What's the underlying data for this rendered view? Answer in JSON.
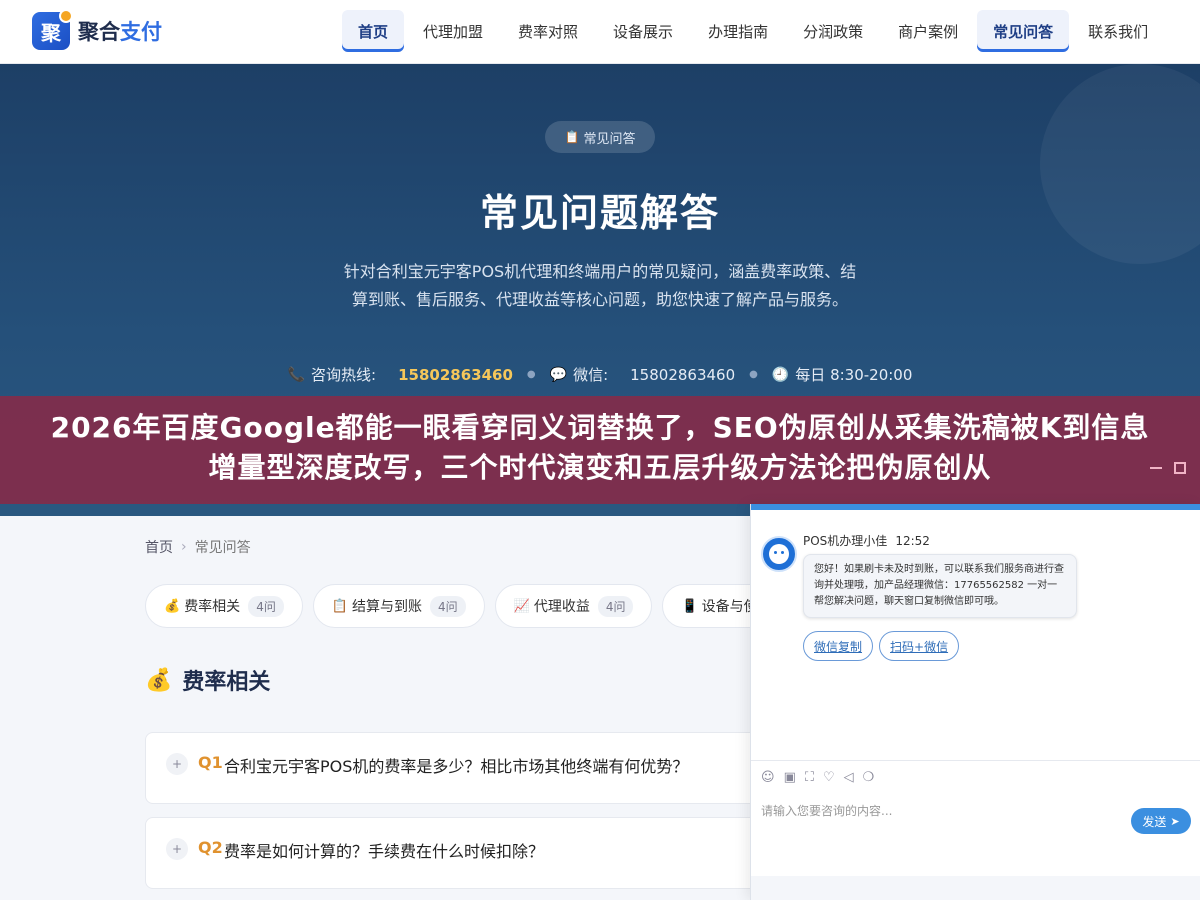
{
  "header": {
    "logo_mark": "聚",
    "logo_text_main": "聚合",
    "logo_text_accent": "支付",
    "nav": [
      {
        "label": "首页",
        "active": true
      },
      {
        "label": "代理加盟",
        "active": false
      },
      {
        "label": "费率对照",
        "active": false
      },
      {
        "label": "设备展示",
        "active": false
      },
      {
        "label": "办理指南",
        "active": false
      },
      {
        "label": "分润政策",
        "active": false
      },
      {
        "label": "商户案例",
        "active": false
      },
      {
        "label": "常见问答",
        "active": true
      },
      {
        "label": "联系我们",
        "active": false
      }
    ]
  },
  "hero": {
    "badge": "常见问答",
    "title": "常见问题解答",
    "description": "针对合利宝元宇客POS机代理和终端用户的常见疑问，涵盖费率政策、结算到账、售后服务、代理收益等核心问题，助您快速了解产品与服务。",
    "hotline_label": "咨询热线:",
    "hotline_value": "15802863460",
    "wechat_label": "微信:",
    "wechat_value": "15802863460",
    "hours": "每日 8:30-20:00"
  },
  "banner": {
    "text": "2026年百度Google都能一眼看穿同义词替换了，SEO伪原创从采集洗稿被K到信息增量型深度改写，三个时代演变和五层升级方法论把伪原创从"
  },
  "breadcrumb": {
    "home": "首页",
    "current": "常见问答"
  },
  "categories": [
    {
      "icon": "💰",
      "label": "费率相关",
      "count": "4问"
    },
    {
      "icon": "📋",
      "label": "结算与到账",
      "count": "4问"
    },
    {
      "icon": "📈",
      "label": "代理收益",
      "count": "4问"
    },
    {
      "icon": "📱",
      "label": "设备与使",
      "count": ""
    }
  ],
  "section": {
    "icon": "💰",
    "title": "费率相关"
  },
  "questions": [
    {
      "num": "Q1",
      "text": "合利宝元宇客POS机的费率是多少？相比市场其他终端有何优势？"
    },
    {
      "num": "Q2",
      "text": "费率是如何计算的？手续费在什么时候扣除？"
    }
  ],
  "chat": {
    "agent_name": "POS机办理小佳",
    "time": "12:52",
    "message": "您好！如果刷卡未及时到账，可以联系我们服务商进行查询并处理哦，加产品经理微信：17765562582 一对一帮您解决问题，聊天窗口复制微信即可哦。",
    "action_copy": "微信复制",
    "action_scan": "扫码+微信",
    "input_placeholder": "请输入您要咨询的内容...",
    "send_label": "发送"
  }
}
